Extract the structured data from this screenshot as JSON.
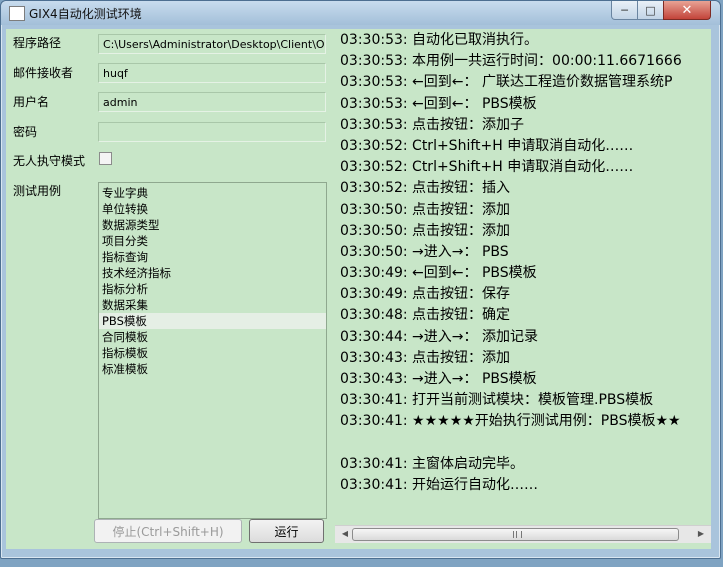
{
  "window": {
    "title": "GIX4自动化测试环境",
    "controls": {
      "minimize": "─",
      "maximize": "□",
      "close": "✕"
    }
  },
  "form": {
    "program_path": {
      "label": "程序路径",
      "value": "C:\\Users\\Administrator\\Desktop\\Client\\OE"
    },
    "mail_recipient": {
      "label": "邮件接收者",
      "value": "huqf"
    },
    "username": {
      "label": "用户名",
      "value": "admin"
    },
    "password": {
      "label": "密码",
      "value": ""
    },
    "unattended": {
      "label": "无人执守模式",
      "checked": false
    },
    "test_cases": {
      "label": "测试用例",
      "items": [
        "专业字典",
        "单位转换",
        "数据源类型",
        "项目分类",
        "指标查询",
        "技术经济指标",
        "指标分析",
        "数据采集",
        "PBS模板",
        "合同模板",
        "指标模板",
        "标准模板"
      ],
      "selected_index": 8
    }
  },
  "buttons": {
    "stop": "停止(Ctrl+Shift+H)",
    "run": "运行"
  },
  "log": {
    "lines": [
      "03:30:53: 自动化已取消执行。",
      "03:30:53: 本用例一共运行时间：00:00:11.6671666",
      "03:30:53: ←回到←：  广联达工程造价数据管理系统P",
      "03:30:53: ←回到←：  PBS模板",
      "03:30:53: 点击按钮：添加子",
      "03:30:52: Ctrl+Shift+H 申请取消自动化……",
      "03:30:52: Ctrl+Shift+H 申请取消自动化……",
      "03:30:52: 点击按钮：插入",
      "03:30:50: 点击按钮：添加",
      "03:30:50: 点击按钮：添加",
      "03:30:50: →进入→：  PBS",
      "03:30:49: ←回到←：  PBS模板",
      "03:30:49: 点击按钮：保存",
      "03:30:48: 点击按钮：确定",
      "03:30:44: →进入→：  添加记录",
      "03:30:43: 点击按钮：添加",
      "03:30:43: →进入→：  PBS模板",
      "03:30:41: 打开当前测试模块：模板管理.PBS模板",
      "03:30:41: ★★★★★开始执行测试用例：PBS模板★★",
      "",
      "03:30:41: 主窗体启动完毕。",
      "03:30:41: 开始运行自动化……"
    ]
  },
  "scrollbar": {
    "left_arrow": "◀",
    "right_arrow": "▶"
  }
}
